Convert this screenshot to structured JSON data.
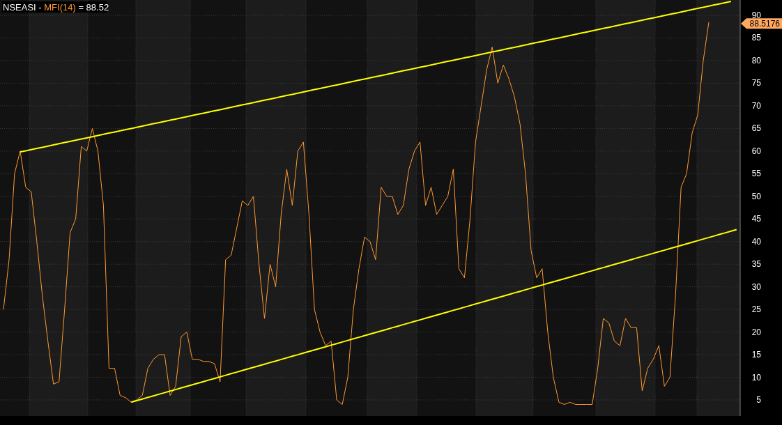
{
  "header": {
    "symbol": "NSEASI",
    "separator": "-",
    "value": "= 88.52"
  },
  "last_value_tag": "88.5176",
  "chart_data": {
    "type": "line",
    "grid": true,
    "ylim": [
      1.46,
      93.39
    ],
    "yticks": [
      5,
      10,
      15,
      20,
      25,
      30,
      35,
      40,
      45,
      50,
      55,
      60,
      65,
      70,
      75,
      80,
      85,
      90
    ],
    "series": [
      {
        "name": "MFI(14)",
        "color": "#ff9933",
        "values": [
          25,
          36,
          55,
          60,
          52,
          51,
          40,
          28,
          18,
          8.5,
          9,
          25,
          42,
          45,
          61,
          60,
          65,
          60,
          48,
          12,
          12,
          6,
          5.5,
          4.5,
          5,
          6,
          12,
          14,
          15,
          15,
          6,
          8,
          19,
          20,
          14,
          14,
          13.5,
          13.5,
          13,
          9,
          36,
          37,
          43,
          49,
          48,
          50,
          35,
          23,
          35,
          30,
          46,
          56,
          48,
          60,
          62,
          46,
          25,
          20,
          17,
          18,
          5,
          4,
          10,
          25,
          34,
          41,
          40,
          36,
          52,
          50,
          50,
          46,
          48,
          56,
          60,
          62,
          48,
          52,
          46,
          48,
          50,
          56,
          34,
          32,
          45,
          62,
          70,
          78,
          83,
          75,
          79,
          76,
          72,
          66,
          55,
          38,
          32,
          34,
          20,
          10,
          4.5,
          4,
          4.5,
          4,
          4,
          4,
          4,
          12,
          23,
          22,
          18,
          17,
          23,
          21,
          21,
          7,
          12,
          14,
          17,
          8,
          10,
          28,
          52,
          55,
          64,
          68,
          80,
          88.5,
          null,
          null,
          null,
          null,
          null
        ]
      },
      {
        "color": "#ffff00",
        "values": [
          null,
          null,
          null,
          59.8,
          60.06,
          60.32,
          60.58,
          60.84,
          61.1,
          61.36,
          61.62,
          61.88,
          62.14,
          62.4,
          62.66,
          62.92,
          63.18,
          63.44,
          63.7,
          63.96,
          64.22,
          64.48,
          64.74,
          65,
          65.26,
          65.52,
          65.78,
          66.04,
          66.3,
          66.56,
          66.82,
          67.08,
          67.34,
          67.6,
          67.86,
          68.12,
          68.38,
          68.64,
          68.9,
          69.16,
          69.42,
          69.68,
          69.94,
          70.2,
          70.46,
          70.72,
          70.98,
          71.24,
          71.5,
          71.76,
          72.02,
          72.28,
          72.54,
          72.8,
          73.06,
          73.32,
          73.58,
          73.84,
          74.1,
          74.36,
          74.62,
          74.88,
          75.14,
          75.4,
          75.66,
          75.92,
          76.18,
          76.44,
          76.7,
          76.96,
          77.22,
          77.48,
          77.74,
          78,
          78.26,
          78.52,
          78.78,
          79.04,
          79.3,
          79.56,
          79.82,
          80.08,
          80.34,
          80.6,
          80.86,
          81.12,
          81.38,
          81.64,
          81.9,
          82.16,
          82.42,
          82.68,
          82.94,
          83.2,
          83.46,
          83.72,
          83.98,
          84.24,
          84.5,
          84.76,
          85.02,
          85.28,
          85.54,
          85.8,
          86.06,
          86.32,
          86.58,
          86.84,
          87.1,
          87.36,
          87.62,
          87.88,
          88.14,
          88.4,
          88.66,
          88.92,
          89.18,
          89.44,
          89.7,
          89.96,
          90.22,
          90.48,
          90.74,
          91,
          91.26,
          91.52,
          91.78,
          92.04,
          92.3,
          92.56,
          92.82,
          93.08,
          null
        ]
      },
      {
        "color": "#ffff00",
        "values": [
          null,
          null,
          null,
          null,
          null,
          null,
          null,
          null,
          null,
          null,
          null,
          null,
          null,
          null,
          null,
          null,
          null,
          null,
          null,
          null,
          null,
          null,
          null,
          4.5,
          4.85,
          5.2,
          5.55,
          5.9,
          6.25,
          6.6,
          6.95,
          7.3,
          7.65,
          8,
          8.35,
          8.7,
          9.05,
          9.4,
          9.75,
          10.1,
          10.45,
          10.8,
          11.15,
          11.5,
          11.85,
          12.2,
          12.55,
          12.9,
          13.25,
          13.6,
          13.95,
          14.3,
          14.65,
          15,
          15.35,
          15.7,
          16.05,
          16.4,
          16.75,
          17.1,
          17.45,
          17.8,
          18.15,
          18.5,
          18.85,
          19.2,
          19.55,
          19.9,
          20.25,
          20.6,
          20.95,
          21.3,
          21.65,
          22,
          22.35,
          22.7,
          23.05,
          23.4,
          23.75,
          24.1,
          24.45,
          24.8,
          25.15,
          25.5,
          25.85,
          26.2,
          26.55,
          26.9,
          27.25,
          27.6,
          27.95,
          28.3,
          28.65,
          29,
          29.35,
          29.7,
          30.05,
          30.4,
          30.75,
          31.1,
          31.45,
          31.8,
          32.15,
          32.5,
          32.85,
          33.2,
          33.55,
          33.9,
          34.25,
          34.6,
          34.95,
          35.3,
          35.65,
          36,
          36.35,
          36.7,
          37.05,
          37.4,
          37.75,
          38.1,
          38.45,
          38.8,
          39.15,
          39.5,
          39.85,
          40.2,
          40.55,
          40.9,
          41.25,
          41.6,
          41.95,
          42.3,
          42.65
        ]
      }
    ]
  }
}
